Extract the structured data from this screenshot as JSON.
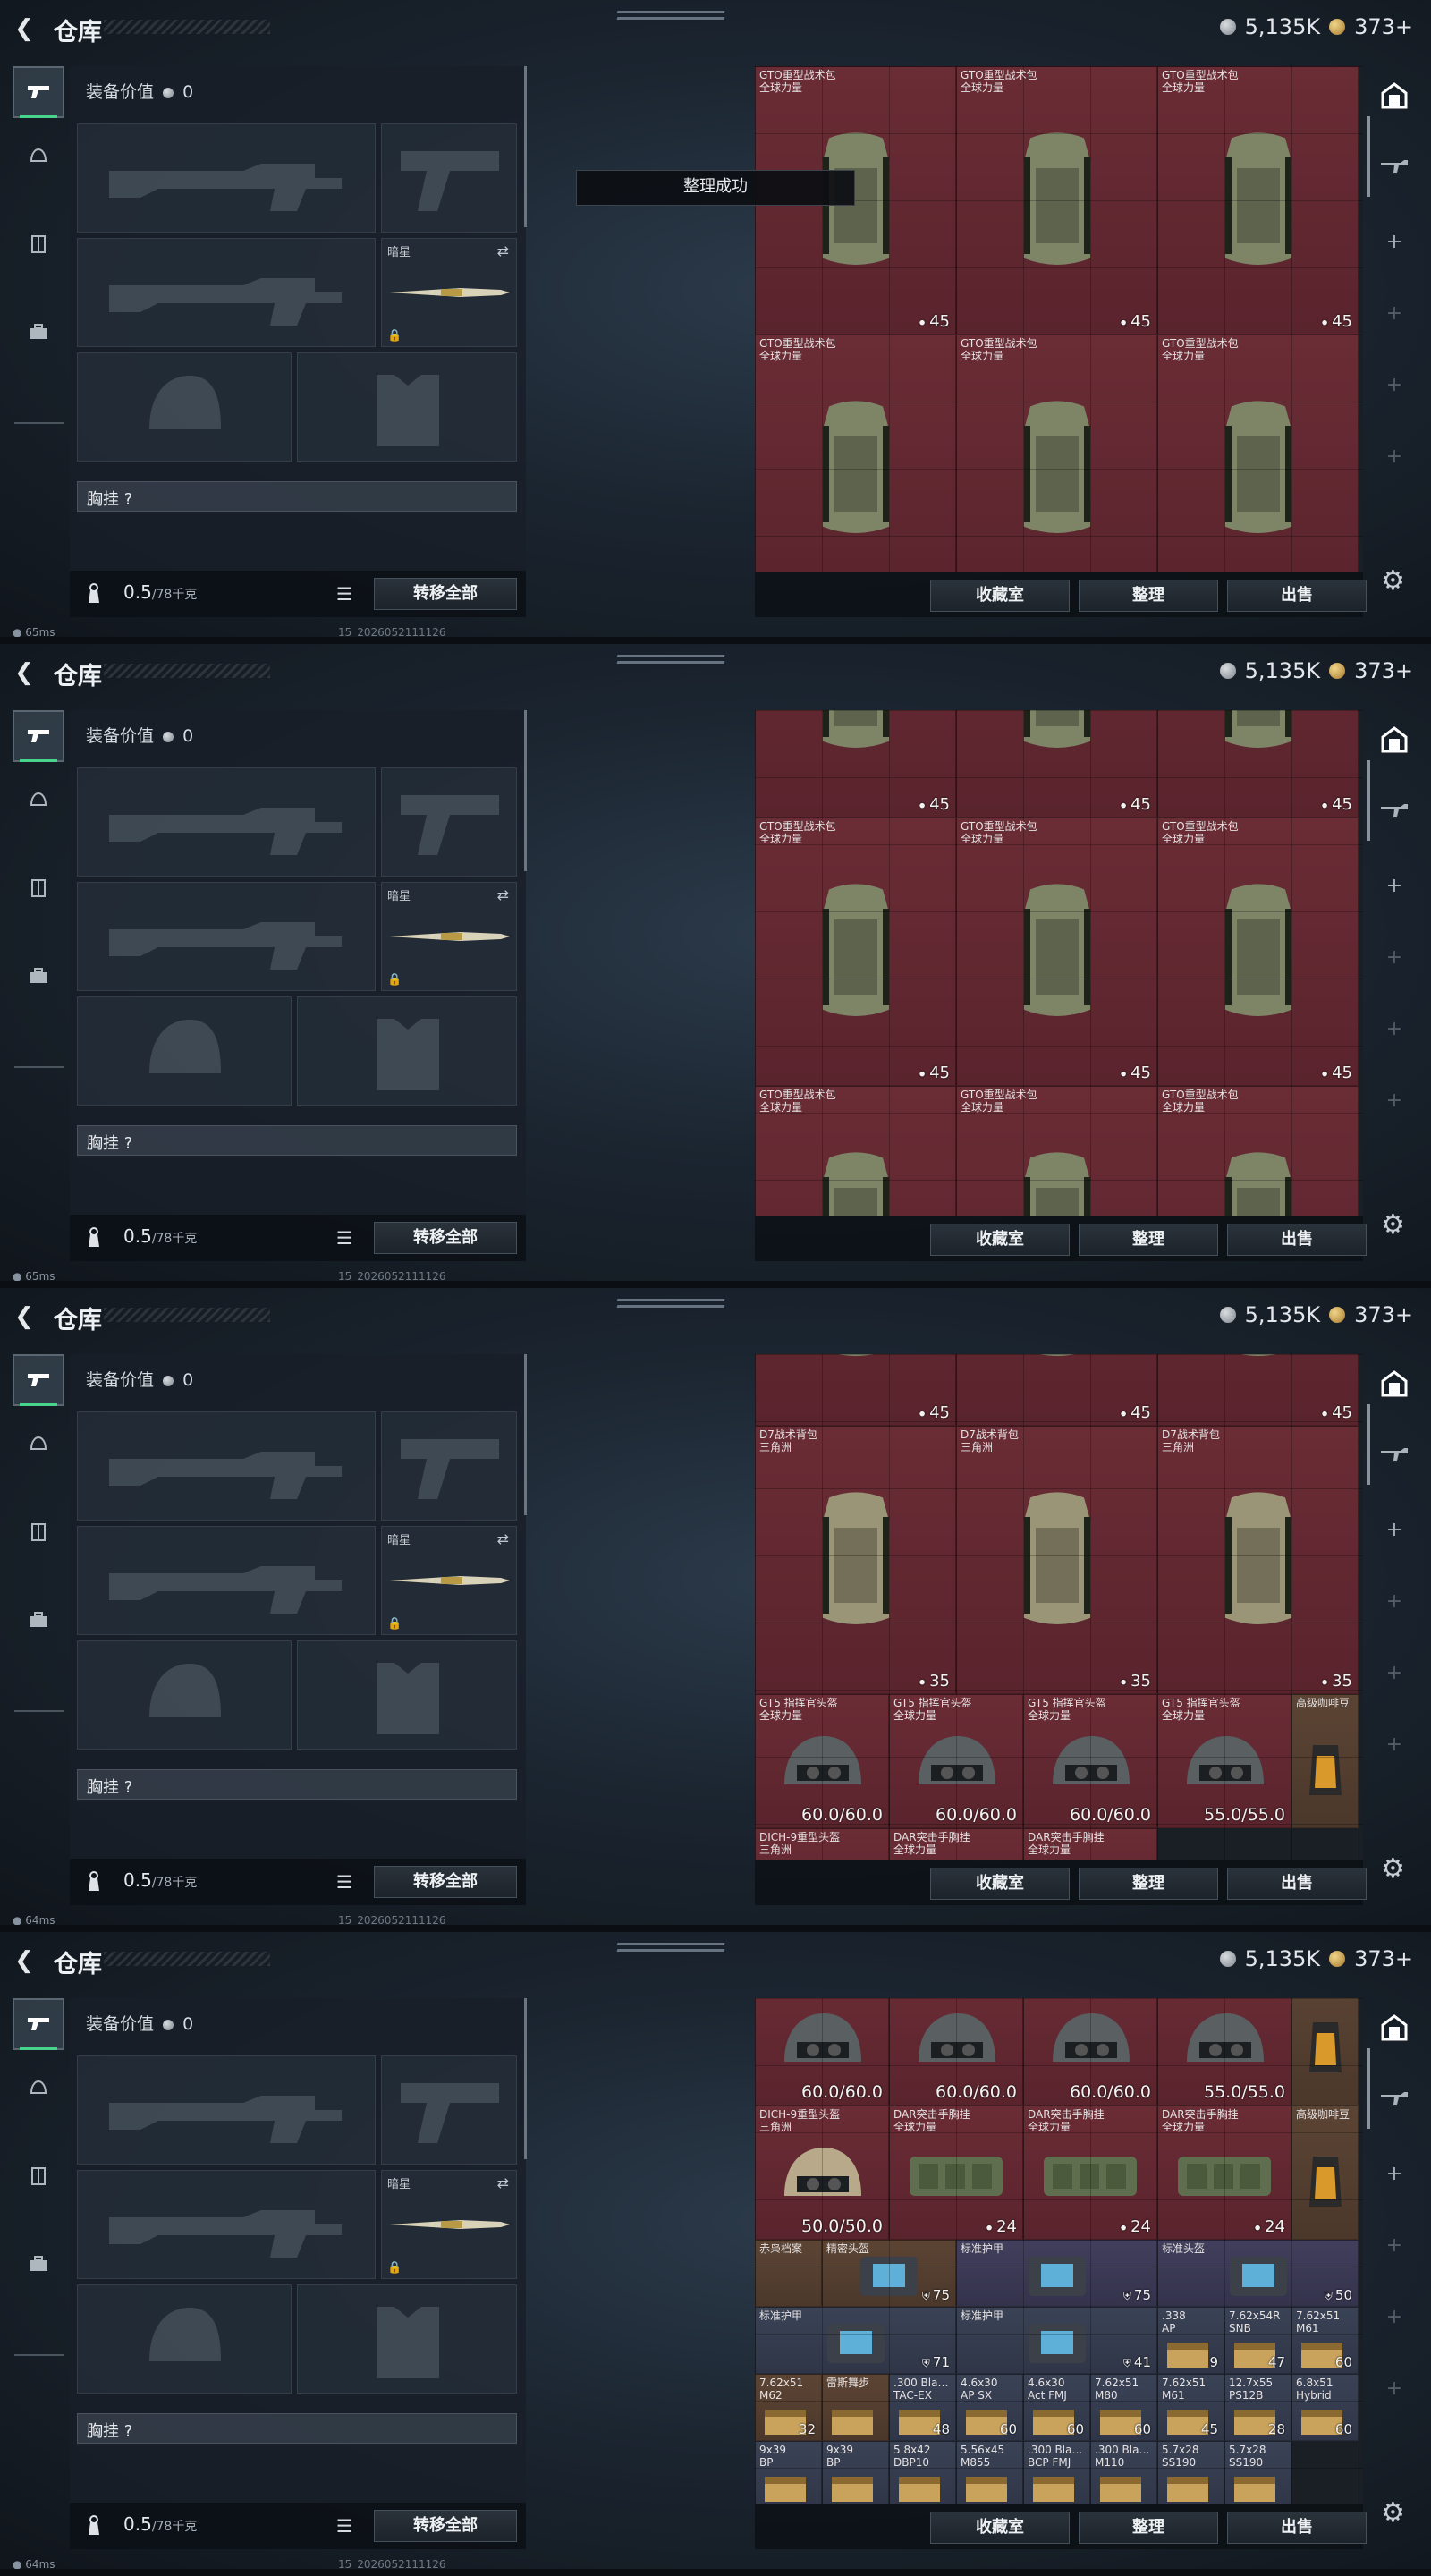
{
  "app": {
    "title": "仓库",
    "currency_silver": "5,135K",
    "currency_gold": "373+",
    "equip_value_label": "装备价值",
    "equip_value": "0",
    "slot_knife_label": "暗星",
    "chest_label": "胸挂 ?",
    "weight_value": "0.5",
    "weight_max": "/78千克",
    "transfer_all": "转移全部",
    "btn_collection": "收藏室",
    "btn_sort": "整理",
    "btn_sell": "出售",
    "toast_sorted": "整理成功",
    "net_status_1": "65ms",
    "net_status_2": "64ms",
    "build_id": "15_2026052111126",
    "colors": {
      "stash_red": "#6a2c35",
      "stash_blue": "#3a4256",
      "stash_brown": "#5c4434",
      "accent_green": "#47d58e"
    }
  },
  "frames": [
    {
      "net": "65ms",
      "toast": true
    },
    {
      "net": "65ms",
      "toast": false
    },
    {
      "net": "64ms",
      "toast": false
    },
    {
      "net": "64ms",
      "toast": false
    }
  ],
  "items": {
    "gto": {
      "name": "GTO重型战术包\n全球力量",
      "count": "45"
    },
    "d7": {
      "name": "D7战术背包\n三角洲",
      "count": "35"
    },
    "gt5": {
      "name": "GT5 指挥官头盔\n全球力量",
      "dur_full": "60.0/60.0",
      "dur_55": "55.0/55.0"
    },
    "coffee": {
      "name": "高级咖啡豆"
    },
    "dich9": {
      "name": "DICH-9重型头盔\n三角洲",
      "dur": "50.0/50.0"
    },
    "dar": {
      "name": "DAR突击手胸挂\n全球力量",
      "count": "24"
    },
    "files": {
      "name": "赤枭档案"
    },
    "helmet_fine": {
      "name": "精密头盔",
      "count": "75"
    },
    "armor_std": {
      "name": "标准护甲",
      "count_75": "75",
      "count_71": "71",
      "count_41": "41"
    },
    "helmet_std": {
      "name": "标准头盔",
      "count": "50"
    },
    "ammo_338": {
      "name": ".338\nAP",
      "count": "9"
    },
    "ammo_762x54r": {
      "name": "7.62x54R\nSNB",
      "count": "47"
    },
    "ammo_762x51_m61": {
      "name": "7.62x51\nM61",
      "count": "60"
    },
    "ammo_762x51_m62": {
      "name": "7.62x51\nM62",
      "count": "32"
    },
    "ammo_blackout": {
      "name": ".300 Bla…\nTAC-EX",
      "count": "48"
    },
    "ammo_46x30_ap": {
      "name": "4.6x30\nAP SX",
      "count": "60"
    },
    "ammo_46x30_act": {
      "name": "4.6x30\nAct FMJ",
      "count": "60"
    },
    "ammo_762x51_m80": {
      "name": "7.62x51\nM80",
      "count": "60"
    },
    "ammo_762x51_m61b": {
      "name": "7.62x51\nM61",
      "count": "45"
    },
    "ammo_127x55": {
      "name": "12.7x55\nPS12B",
      "count": "28"
    },
    "ammo_68x51": {
      "name": "6.8x51\nHybrid",
      "count": "60"
    },
    "ammo_9x39": {
      "name": "9x39\nBP",
      "count": ""
    },
    "ammo_9x39b": {
      "name": "9x39\nBP",
      "count": ""
    },
    "ammo_58x42": {
      "name": "5.8x42\nDBP10",
      "count": ""
    },
    "ammo_556": {
      "name": "5.56x45\nM855",
      "count": ""
    },
    "ammo_300b": {
      "name": ".300 Bla…\nBCP FMJ",
      "count": ""
    },
    "ammo_300c": {
      "name": ".300 Bla…\nM110",
      "count": ""
    },
    "ammo_57a": {
      "name": "5.7x28\nSS190",
      "count": ""
    },
    "ammo_57b": {
      "name": "5.7x28\nSS190",
      "count": ""
    },
    "energy": {
      "name": "雷斯舞步",
      "count": ""
    }
  }
}
